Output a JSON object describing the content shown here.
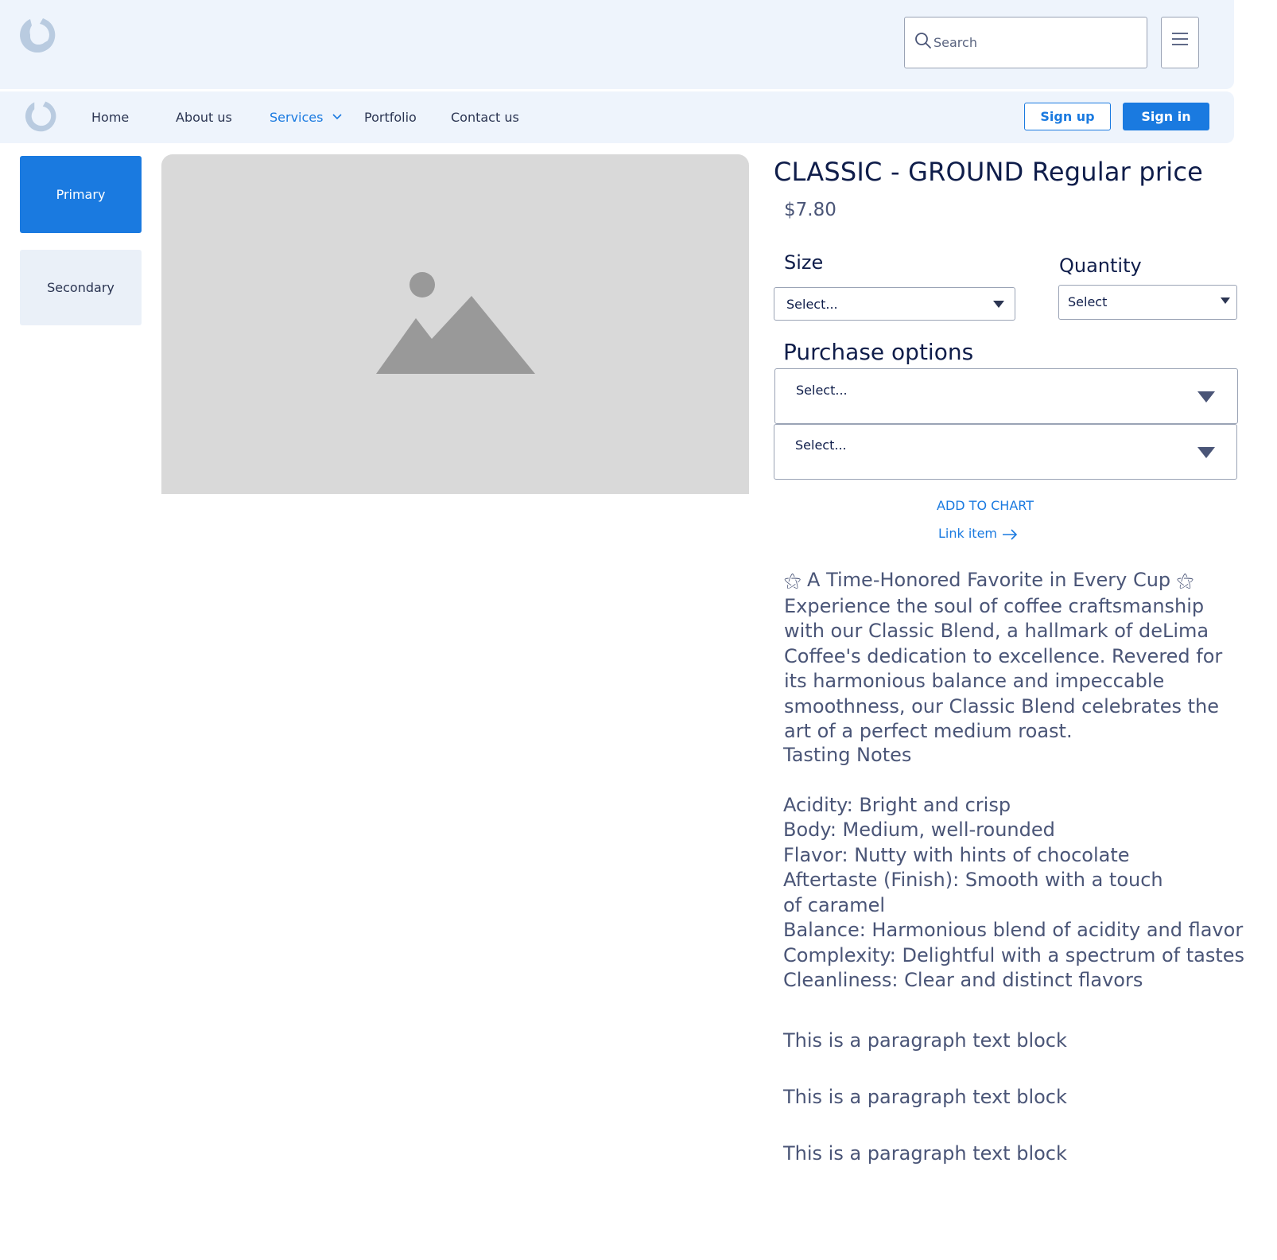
{
  "header": {
    "search_placeholder": "Search"
  },
  "nav": {
    "items": [
      {
        "label": "Home"
      },
      {
        "label": "About us"
      },
      {
        "label": "Services"
      },
      {
        "label": "Portfolio"
      },
      {
        "label": "Contact us"
      }
    ],
    "active": "Services",
    "signup_label": "Sign up",
    "signin_label": "Sign in"
  },
  "sidebar": {
    "primary_label": "Primary",
    "secondary_label": "Secondary"
  },
  "product": {
    "title": "CLASSIC - GROUND Regular price",
    "price": "$7.80",
    "size_label": "Size",
    "size_value": "Select...",
    "quantity_label": "Quantity",
    "quantity_value": "Select",
    "purchase_label": "Purchase options",
    "purchase_select_1": "Select...",
    "purchase_select_2": "Select...",
    "add_to_cart": "ADD TO CHART",
    "link_item": "Link item",
    "description": {
      "star": "⚝",
      "headline": "A Time-Honored Favorite in Every Cup",
      "body": "Experience the soul of coffee craftsmanship with our Classic Blend, a hallmark of deLima Coffee's dedication to excellence. Revered for its harmonious balance and impeccable smoothness, our Classic Blend celebrates the art of a perfect medium roast."
    },
    "tasting": {
      "heading": "Tasting Notes",
      "notes": [
        "Acidity: Bright and crisp",
        "Body: Medium, well-rounded",
        "Flavor: Nutty with hints of chocolate",
        "Aftertaste (Finish): Smooth with a touch of caramel",
        "Balance: Harmonious blend of acidity and flavor",
        "Complexity: Delightful with a spectrum of tastes",
        "Cleanliness: Clear and distinct flavors"
      ]
    },
    "paragraphs": [
      "This is a paragraph text block",
      "This is a paragraph text block",
      "This is a paragraph text block"
    ]
  },
  "colors": {
    "accent": "#1a7ae0",
    "header_bg": "#eef4fc",
    "heading": "#0f1d4a",
    "body_text": "#4a5577",
    "placeholder_bg": "#d9d9d9"
  }
}
